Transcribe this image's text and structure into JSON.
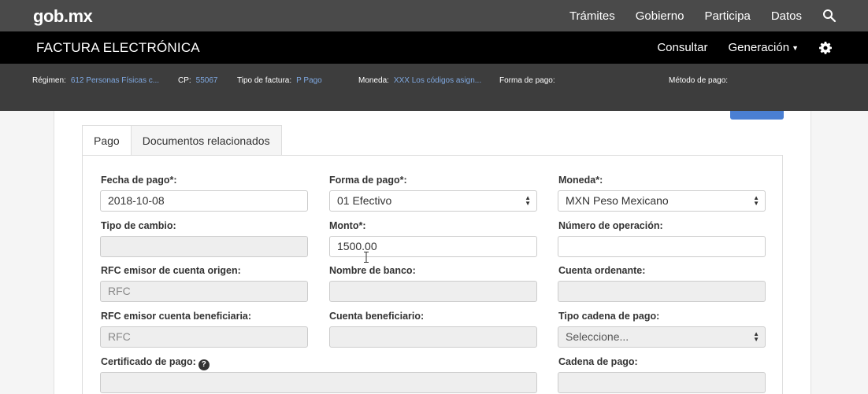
{
  "topbar": {
    "logo": "gob",
    "logo_suffix": "mx",
    "nav": [
      "Trámites",
      "Gobierno",
      "Participa",
      "Datos"
    ]
  },
  "appbar": {
    "title": "FACTURA ELECTRÓNICA",
    "consultar": "Consultar",
    "generacion": "Generación"
  },
  "info": {
    "regimen_label": "Régimen:",
    "regimen_value": "612 Personas Físicas c...",
    "cp_label": "CP:",
    "cp_value": "55067",
    "tipo_label": "Tipo de factura:",
    "tipo_value": "P Pago",
    "moneda_label": "Moneda:",
    "moneda_value": "XXX Los códigos asign...",
    "forma_label": "Forma de pago:",
    "metodo_label": "Método de pago:"
  },
  "tabs": [
    "Pago",
    "Documentos relacionados"
  ],
  "form": {
    "fecha_label": "Fecha de pago*:",
    "fecha_value": "2018-10-08",
    "forma_label": "Forma de pago*:",
    "forma_value": "01 Efectivo",
    "moneda_label": "Moneda*:",
    "moneda_value": "MXN Peso Mexicano",
    "tipo_cambio_label": "Tipo de cambio:",
    "monto_label": "Monto*:",
    "monto_value": "1500.00",
    "num_op_label": "Número de operación:",
    "rfc_origen_label": "RFC emisor de cuenta origen:",
    "rfc_origen_placeholder": "RFC",
    "banco_label": "Nombre de banco:",
    "cuenta_ord_label": "Cuenta ordenante:",
    "rfc_benef_label": "RFC emisor cuenta beneficiaria:",
    "rfc_benef_placeholder": "RFC",
    "cuenta_benef_label": "Cuenta beneficiario:",
    "tipo_cadena_label": "Tipo cadena de pago:",
    "tipo_cadena_value": "Seleccione...",
    "certificado_label": "Certificado de pago:",
    "cadena_label": "Cadena de pago:"
  },
  "colors": {
    "link": "#7fa8e0",
    "accent": "#4a7fd3"
  }
}
